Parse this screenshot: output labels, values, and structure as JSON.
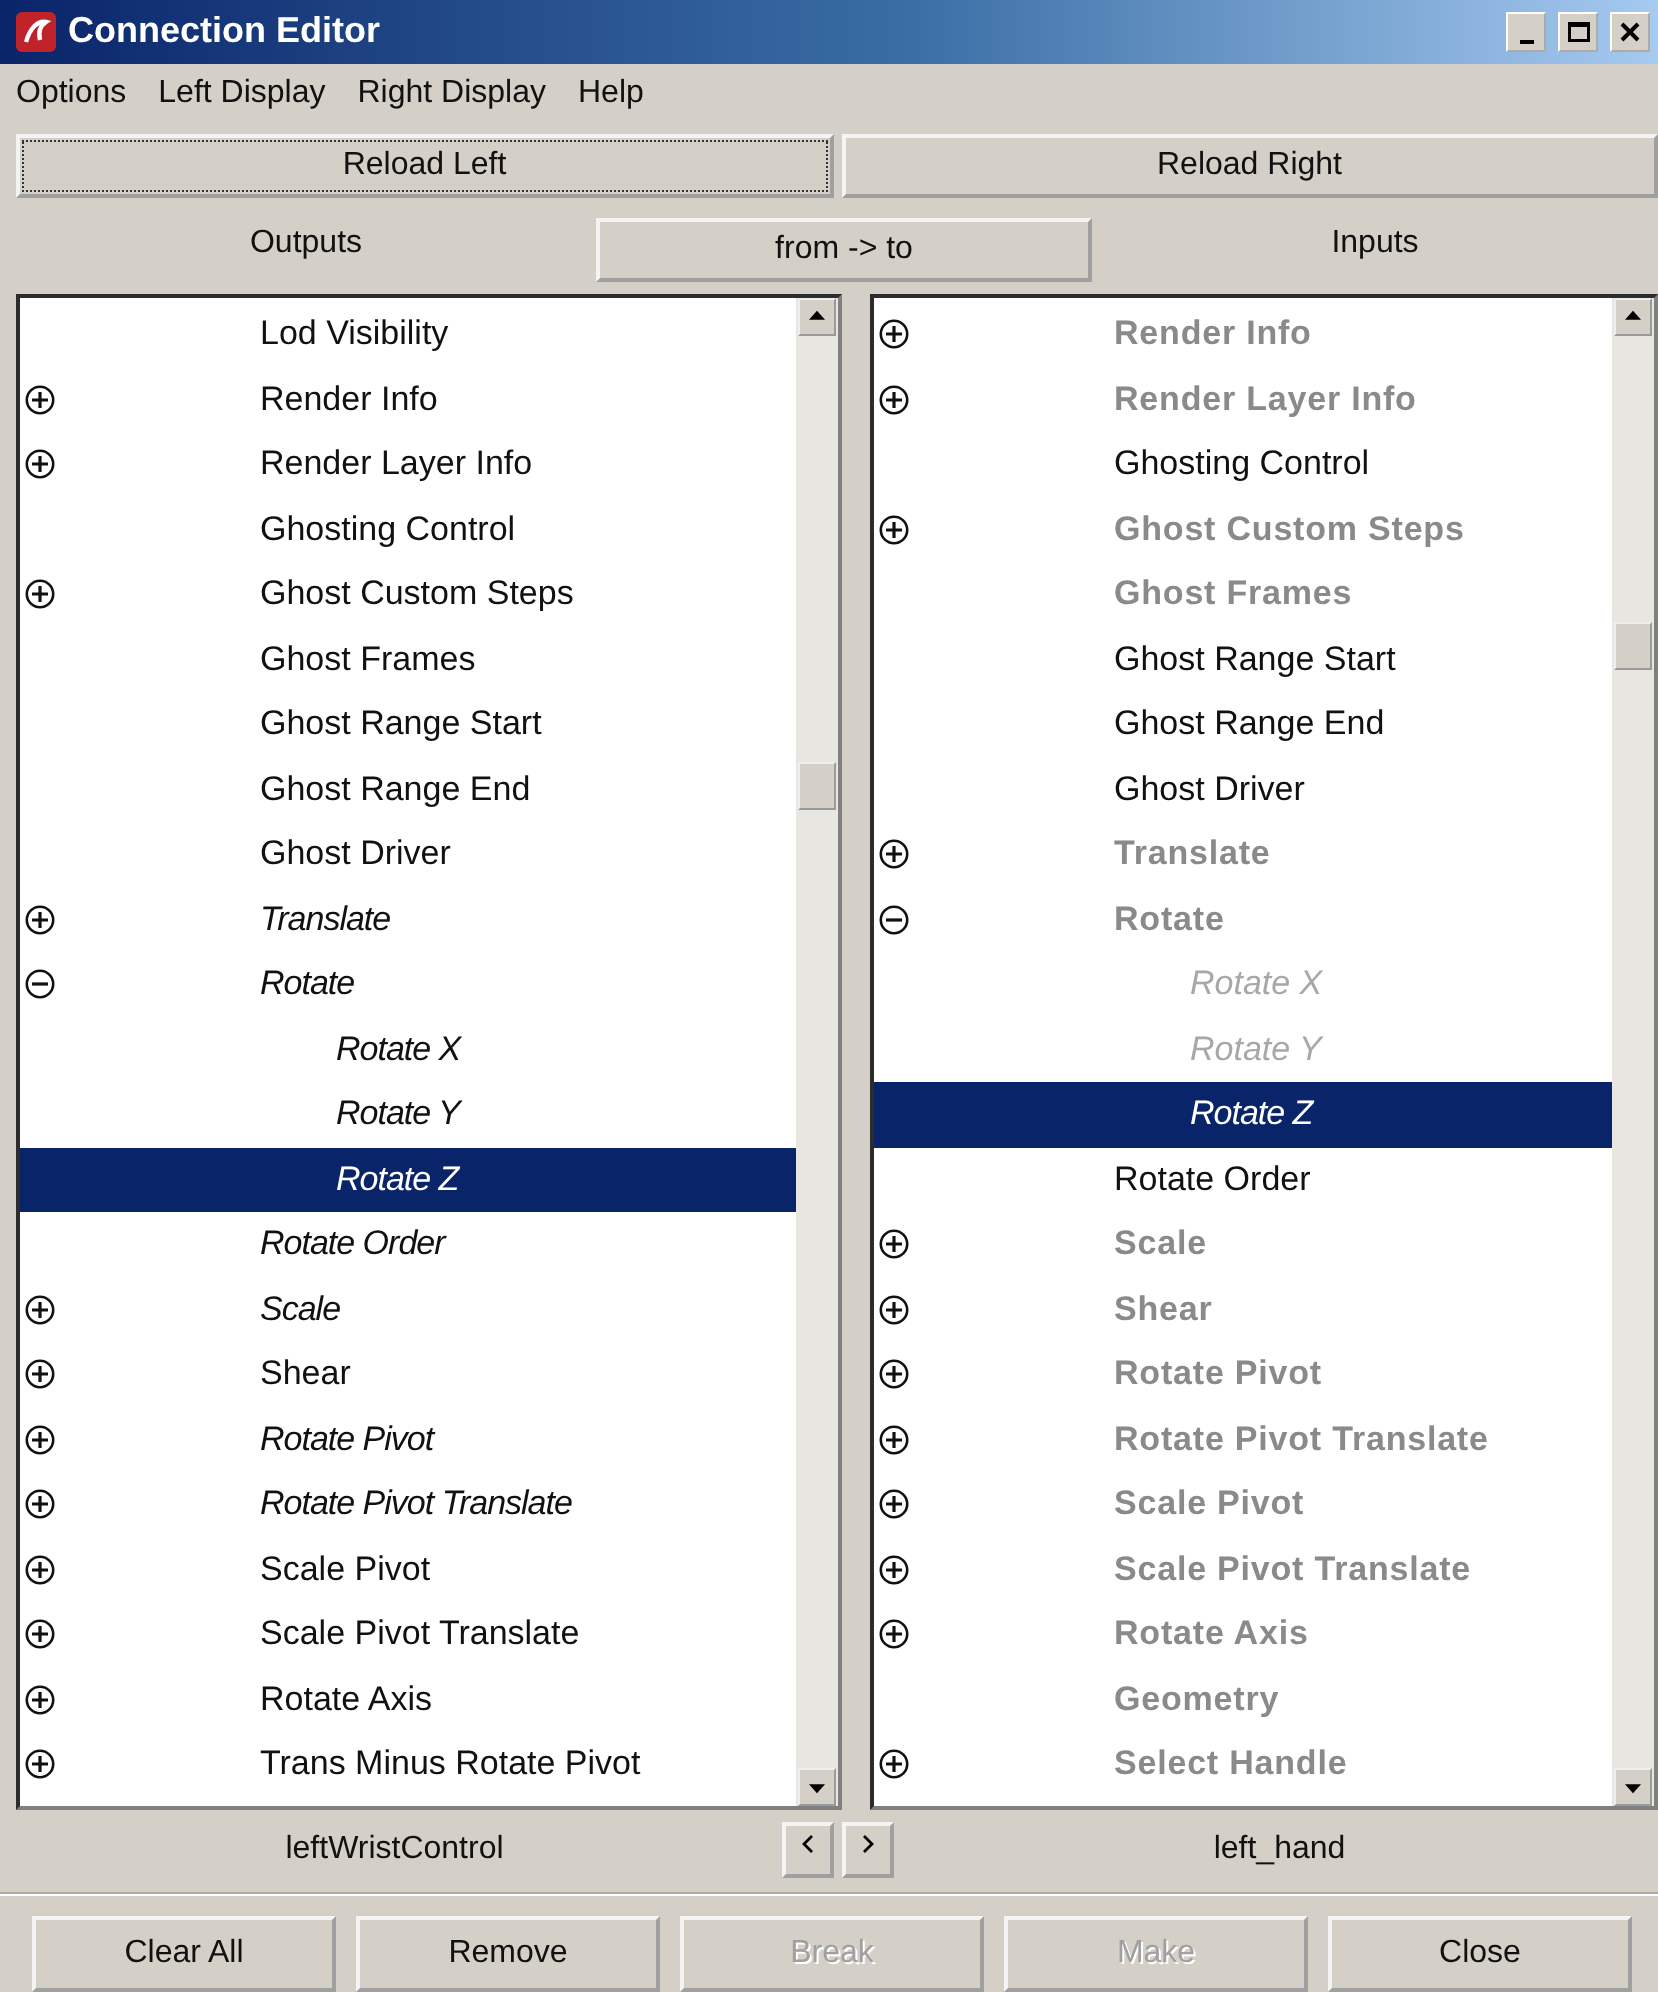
{
  "window": {
    "title": "Connection Editor"
  },
  "menu": [
    "Options",
    "Left Display",
    "Right Display",
    "Help"
  ],
  "reload_buttons": [
    {
      "label": "Reload Left",
      "focused": true
    },
    {
      "label": "Reload Right",
      "focused": false
    }
  ],
  "header": {
    "left": "Outputs",
    "direction": "from -> to",
    "right": "Inputs"
  },
  "left_list": {
    "items": [
      {
        "label": "Lod Visibility",
        "kind": "plain",
        "selected": false
      },
      {
        "label": "Render Info",
        "kind": "plain",
        "expanded": false,
        "selected": false
      },
      {
        "label": "Render Layer Info",
        "kind": "plain",
        "expanded": false,
        "selected": false
      },
      {
        "label": "Ghosting Control",
        "kind": "plain",
        "selected": false
      },
      {
        "label": "Ghost Custom Steps",
        "kind": "plain",
        "expanded": false,
        "selected": false
      },
      {
        "label": "Ghost Frames",
        "kind": "plain",
        "selected": false
      },
      {
        "label": "Ghost Range Start",
        "kind": "plain",
        "selected": false
      },
      {
        "label": "Ghost Range End",
        "kind": "plain",
        "selected": false
      },
      {
        "label": "Ghost Driver",
        "kind": "plain",
        "selected": false
      },
      {
        "label": "Translate",
        "kind": "italic",
        "expanded": false,
        "selected": false
      },
      {
        "label": "Rotate",
        "kind": "italic",
        "expanded": true,
        "selected": false,
        "children": [
          {
            "label": "Rotate X",
            "kind": "italic",
            "selected": false
          },
          {
            "label": "Rotate Y",
            "kind": "italic",
            "selected": false
          },
          {
            "label": "Rotate Z",
            "kind": "italic",
            "selected": true
          }
        ]
      },
      {
        "label": "Rotate Order",
        "kind": "italic",
        "selected": false
      },
      {
        "label": "Scale",
        "kind": "italic",
        "expanded": false,
        "selected": false
      },
      {
        "label": "Shear",
        "kind": "plain",
        "expanded": false,
        "selected": false
      },
      {
        "label": "Rotate Pivot",
        "kind": "italic",
        "expanded": false,
        "selected": false
      },
      {
        "label": "Rotate Pivot Translate",
        "kind": "italic",
        "expanded": false,
        "selected": false
      },
      {
        "label": "Scale Pivot",
        "kind": "plain",
        "expanded": false,
        "selected": false
      },
      {
        "label": "Scale Pivot Translate",
        "kind": "plain",
        "expanded": false,
        "selected": false
      },
      {
        "label": "Rotate Axis",
        "kind": "plain",
        "expanded": false,
        "selected": false
      },
      {
        "label": "Trans Minus Rotate Pivot",
        "kind": "plain",
        "expanded": false,
        "selected": false
      }
    ]
  },
  "right_list": {
    "items": [
      {
        "label": "Render Info",
        "kind": "greyed",
        "expanded": false,
        "selected": false
      },
      {
        "label": "Render Layer Info",
        "kind": "greyed",
        "expanded": false,
        "selected": false
      },
      {
        "label": "Ghosting Control",
        "kind": "plain",
        "selected": false
      },
      {
        "label": "Ghost Custom Steps",
        "kind": "greyed",
        "expanded": false,
        "selected": false
      },
      {
        "label": "Ghost Frames",
        "kind": "greyed",
        "selected": false
      },
      {
        "label": "Ghost Range Start",
        "kind": "plain",
        "selected": false
      },
      {
        "label": "Ghost Range End",
        "kind": "plain",
        "selected": false
      },
      {
        "label": "Ghost Driver",
        "kind": "plain",
        "selected": false
      },
      {
        "label": "Translate",
        "kind": "greyed",
        "expanded": false,
        "selected": false
      },
      {
        "label": "Rotate",
        "kind": "greyed",
        "expanded": true,
        "selected": false,
        "children": [
          {
            "label": "Rotate X",
            "kind": "greyed-italic",
            "selected": false
          },
          {
            "label": "Rotate Y",
            "kind": "greyed-italic",
            "selected": false
          },
          {
            "label": "Rotate Z",
            "kind": "italic",
            "selected": true
          }
        ]
      },
      {
        "label": "Rotate Order",
        "kind": "plain",
        "selected": false
      },
      {
        "label": "Scale",
        "kind": "greyed",
        "expanded": false,
        "selected": false
      },
      {
        "label": "Shear",
        "kind": "greyed",
        "expanded": false,
        "selected": false
      },
      {
        "label": "Rotate Pivot",
        "kind": "greyed",
        "expanded": false,
        "selected": false
      },
      {
        "label": "Rotate Pivot Translate",
        "kind": "greyed",
        "expanded": false,
        "selected": false
      },
      {
        "label": "Scale Pivot",
        "kind": "greyed",
        "expanded": false,
        "selected": false
      },
      {
        "label": "Scale Pivot Translate",
        "kind": "greyed",
        "expanded": false,
        "selected": false
      },
      {
        "label": "Rotate Axis",
        "kind": "greyed",
        "expanded": false,
        "selected": false
      },
      {
        "label": "Geometry",
        "kind": "greyed",
        "selected": false
      },
      {
        "label": "Select Handle",
        "kind": "greyed",
        "expanded": false,
        "selected": false
      }
    ]
  },
  "node_bar": {
    "left": "leftWristControl",
    "right": "left_hand"
  },
  "buttons": [
    {
      "label": "Clear All",
      "disabled": false
    },
    {
      "label": "Remove",
      "disabled": false
    },
    {
      "label": "Break",
      "disabled": true
    },
    {
      "label": "Make",
      "disabled": true
    },
    {
      "label": "Close",
      "disabled": false
    }
  ]
}
